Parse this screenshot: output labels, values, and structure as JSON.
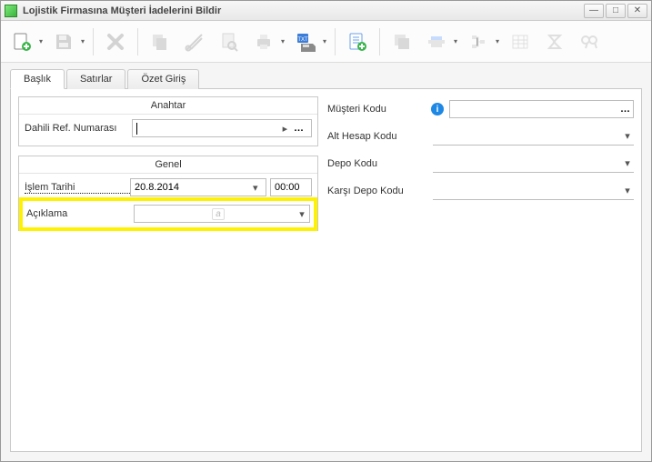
{
  "window": {
    "title": "Lojistik Firmasına Müşteri İadelerini Bildir"
  },
  "tabs": {
    "t0": "Başlık",
    "t1": "Satırlar",
    "t2": "Özet Giriş"
  },
  "groups": {
    "anahtar": "Anahtar",
    "genel": "Genel"
  },
  "left": {
    "dahili_ref_label": "Dahili Ref. Numarası",
    "dahili_ref_value": "",
    "islem_tarihi_label": "İşlem Tarihi",
    "islem_tarihi_date": "20.8.2014",
    "islem_tarihi_time": "00:00",
    "aciklama_label": "Açıklama",
    "aciklama_value": ""
  },
  "right": {
    "musteri_kodu_label": "Müşteri Kodu",
    "musteri_kodu_value": "",
    "alt_hesap_label": "Alt Hesap Kodu",
    "alt_hesap_value": "",
    "depo_label": "Depo Kodu",
    "depo_value": "",
    "karsi_depo_label": "Karşı Depo Kodu",
    "karsi_depo_value": ""
  },
  "glyphs": {
    "min": "—",
    "max": "□",
    "close": "✕",
    "chev_down": "▾",
    "chev_right": "▸",
    "dots": "…",
    "info": "i"
  }
}
